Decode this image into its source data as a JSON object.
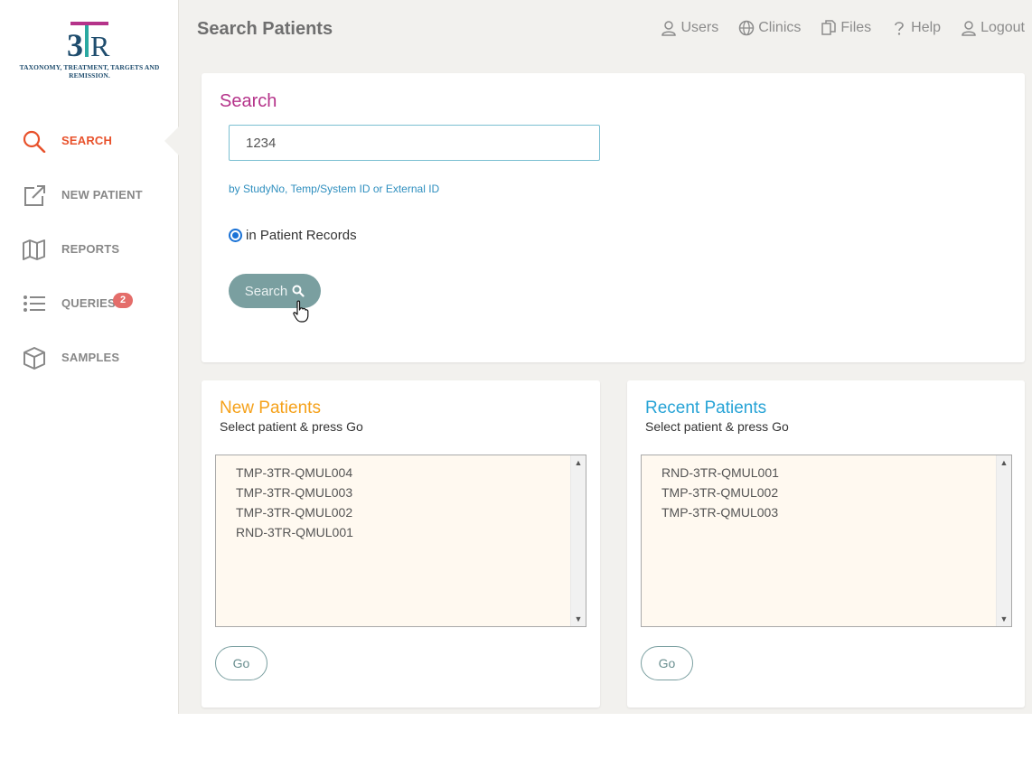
{
  "brand": {
    "logo_text": "3TR",
    "tagline": "TAXONOMY, TREATMENT, TARGETS AND REMISSION."
  },
  "sidebar": {
    "items": [
      {
        "label": "SEARCH",
        "icon": "search-icon",
        "active": true
      },
      {
        "label": "NEW PATIENT",
        "icon": "external-link-icon",
        "active": false
      },
      {
        "label": "REPORTS",
        "icon": "map-icon",
        "active": false
      },
      {
        "label": "QUERIES",
        "icon": "list-icon",
        "active": false,
        "badge": "2"
      },
      {
        "label": "SAMPLES",
        "icon": "box-icon",
        "active": false
      }
    ]
  },
  "header": {
    "title": "Search Patients",
    "nav": [
      {
        "label": "Users",
        "icon": "user-icon"
      },
      {
        "label": "Clinics",
        "icon": "globe-icon"
      },
      {
        "label": "Files",
        "icon": "files-icon"
      },
      {
        "label": "Help",
        "icon": "question-icon"
      },
      {
        "label": "Logout",
        "icon": "user-icon"
      }
    ]
  },
  "search": {
    "heading": "Search",
    "value": "1234",
    "hint": "by StudyNo, Temp/System ID or External ID",
    "scope_label": "in Patient Records",
    "button_label": "Search"
  },
  "new_patients": {
    "heading": "New Patients",
    "subtitle": "Select patient & press Go",
    "items": [
      "TMP-3TR-QMUL004",
      "TMP-3TR-QMUL003",
      "TMP-3TR-QMUL002",
      "RND-3TR-QMUL001"
    ],
    "go_label": "Go"
  },
  "recent_patients": {
    "heading": "Recent Patients",
    "subtitle": "Select patient & press Go",
    "items": [
      "RND-3TR-QMUL001",
      "TMP-3TR-QMUL002",
      "TMP-3TR-QMUL003"
    ],
    "go_label": "Go"
  },
  "colors": {
    "active_nav": "#e8522c",
    "search_heading": "#b5338a",
    "new_heading": "#f5a11a",
    "recent_heading": "#27a3d6",
    "button": "#7a9fa0",
    "badge": "#e46d6a"
  }
}
